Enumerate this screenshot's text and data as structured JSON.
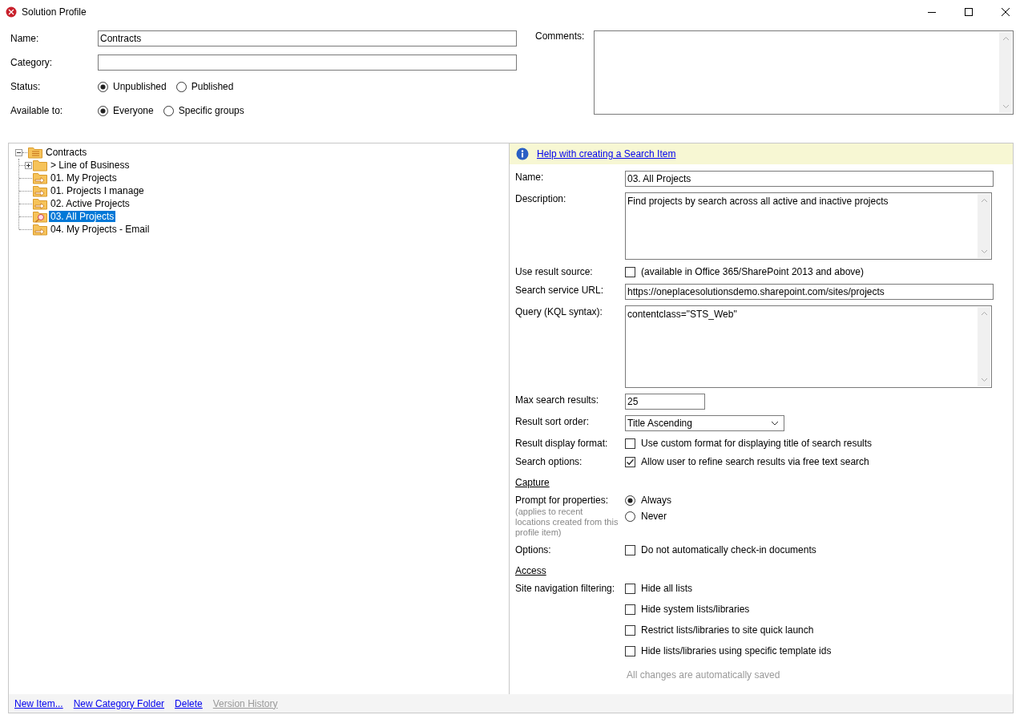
{
  "window": {
    "title": "Solution Profile"
  },
  "profile": {
    "name": {
      "label": "Name:",
      "value": "Contracts"
    },
    "category": {
      "label": "Category:"
    },
    "radio_groups": [
      {
        "label": "Status:",
        "options": [
          {
            "label": "Unpublished",
            "selected": true
          },
          {
            "label": "Published",
            "selected": false
          }
        ]
      },
      {
        "label": "Available to:",
        "options": [
          {
            "label": "Everyone",
            "selected": true
          },
          {
            "label": "Specific groups",
            "selected": false
          }
        ]
      }
    ],
    "comments": {
      "label": "Comments:"
    }
  },
  "tree": {
    "label": "Contracts",
    "kind": "category",
    "expanded": true,
    "selected": false,
    "children": [
      {
        "label": "> Line of Business",
        "kind": "folder",
        "expanded": false,
        "selected": false
      },
      {
        "label": "01. My Projects",
        "kind": "item",
        "selected": false
      },
      {
        "label": "01. Projects I manage",
        "kind": "item",
        "selected": false
      },
      {
        "label": "02. Active Projects",
        "kind": "item",
        "selected": false
      },
      {
        "label": "03. All Projects",
        "kind": "search",
        "selected": true
      },
      {
        "label": "04. My Projects - Email",
        "kind": "item",
        "selected": false
      }
    ]
  },
  "details": {
    "help_link": "Help with creating a Search Item",
    "rows": [
      {
        "kind": "text",
        "label": "Name:",
        "value": "03. All Projects"
      },
      {
        "kind": "textarea",
        "label": "Description:",
        "value": "Find projects by search across all active and inactive projects"
      },
      {
        "kind": "checkbox",
        "label": "Use result source:",
        "checks": [
          {
            "text": "(available in Office 365/SharePoint 2013 and above)",
            "checked": false
          }
        ]
      },
      {
        "kind": "text",
        "label": "Search service URL:",
        "value": "https://oneplacesolutionsdemo.sharepoint.com/sites/projects"
      },
      {
        "kind": "textarea",
        "label": "Query (KQL syntax):",
        "value": "contentclass=\"STS_Web\""
      },
      {
        "kind": "short",
        "label": "Max search results:",
        "value": "25"
      },
      {
        "kind": "dropdown",
        "label": "Result sort order:",
        "value": "Title Ascending"
      },
      {
        "kind": "checkbox",
        "label": "Result display format:",
        "checks": [
          {
            "text": "Use custom format for displaying title of search results",
            "checked": false
          }
        ]
      },
      {
        "kind": "checkbox",
        "label": "Search options:",
        "checks": [
          {
            "text": "Allow user to refine search results via free text search",
            "checked": true
          }
        ]
      },
      {
        "kind": "heading",
        "label": "Capture"
      },
      {
        "kind": "radio",
        "label": "Prompt for properties:",
        "note": "(applies to recent locations created from this profile item)",
        "options": [
          {
            "label": "Always",
            "selected": true
          },
          {
            "label": "Never",
            "selected": false
          }
        ]
      },
      {
        "kind": "checkbox",
        "label": "Options:",
        "checks": [
          {
            "text": "Do not automatically check-in documents",
            "checked": false
          }
        ]
      },
      {
        "kind": "heading",
        "label": "Access"
      },
      {
        "kind": "checkbox",
        "label": "Site navigation filtering:",
        "checks": [
          {
            "text": "Hide all lists",
            "checked": false
          },
          {
            "text": "Hide system lists/libraries",
            "checked": false
          },
          {
            "text": "Restrict lists/libraries to site quick launch",
            "checked": false
          },
          {
            "text": "Hide lists/libraries using specific template ids",
            "checked": false
          }
        ]
      },
      {
        "kind": "note",
        "label": "All changes are automatically saved"
      }
    ]
  },
  "footer_links": [
    {
      "label": "New Item...",
      "disabled": false
    },
    {
      "label": "New Category Folder",
      "disabled": false
    },
    {
      "label": "Delete",
      "disabled": false
    },
    {
      "label": "Version History",
      "disabled": true
    }
  ]
}
